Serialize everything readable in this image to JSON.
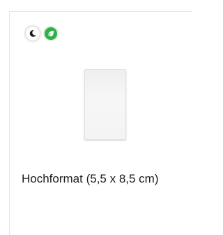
{
  "product": {
    "title": "Hochformat (5,5 x 8,5 cm)",
    "badges": [
      {
        "icon": "moon-icon",
        "meaning": "night-mode"
      },
      {
        "icon": "leaf-icon",
        "meaning": "eco"
      }
    ],
    "preview_icon": "portrait-card-preview"
  },
  "colors": {
    "eco_green": "#31b04a",
    "text": "#1a1a1a",
    "border": "#e6e6e6"
  }
}
